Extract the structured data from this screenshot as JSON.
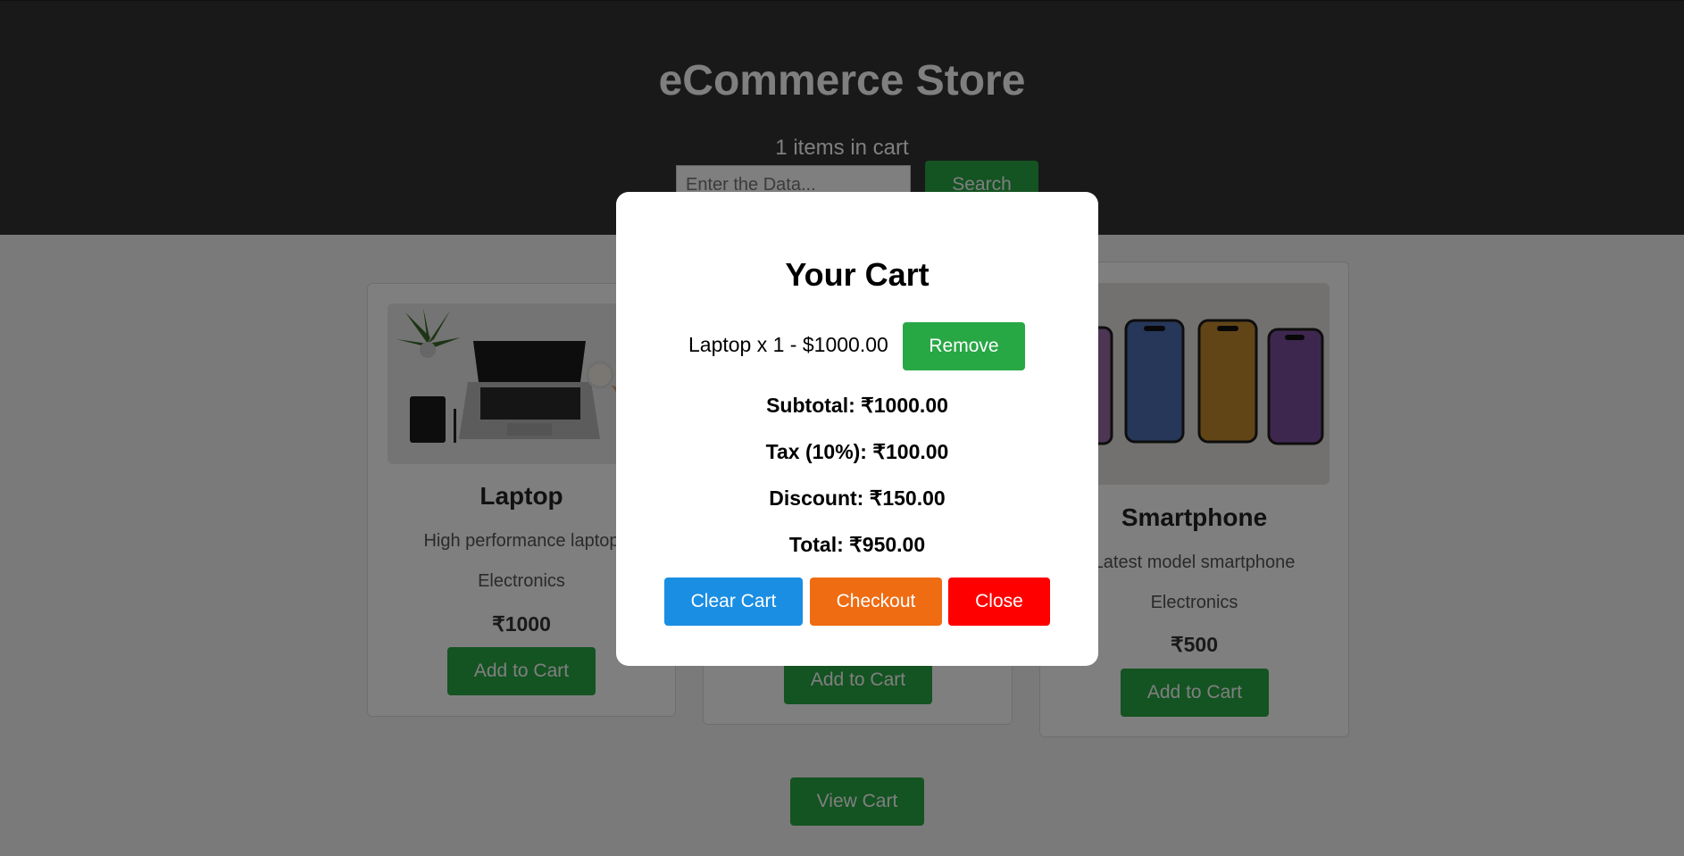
{
  "header": {
    "title": "eCommerce Store",
    "cart_count_text": "1 items in cart",
    "search_placeholder": "Enter the Data...",
    "search_label": "Search"
  },
  "products": [
    {
      "name": "Laptop",
      "description": "High performance laptop",
      "category": "Electronics",
      "price": "₹1000",
      "button": "Add to Cart"
    },
    {
      "button": "Add to Cart"
    },
    {
      "name": "Smartphone",
      "description": "Latest model smartphone",
      "category": "Electronics",
      "price": "₹500",
      "button": "Add to Cart"
    }
  ],
  "view_cart_label": "View Cart",
  "modal": {
    "title": "Your Cart",
    "items": [
      {
        "text": "Laptop x 1 - $1000.00",
        "remove_label": "Remove"
      }
    ],
    "subtotal": "Subtotal: ₹1000.00",
    "tax": "Tax (10%): ₹100.00",
    "discount": "Discount: ₹150.00",
    "total": "Total: ₹950.00",
    "clear_label": "Clear Cart",
    "checkout_label": "Checkout",
    "close_label": "Close"
  },
  "colors": {
    "header_bg": "#333333",
    "primary_green": "#28a745",
    "clear_blue": "#1a8ee3",
    "checkout_orange": "#ef6c12",
    "close_red": "#ff0000"
  }
}
